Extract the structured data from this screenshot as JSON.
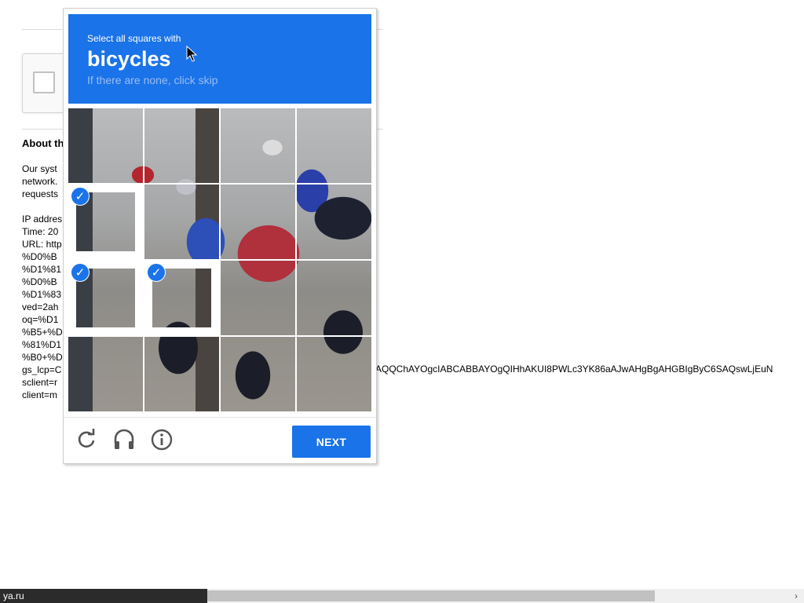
{
  "background_page": {
    "about_heading": "About th",
    "paragraph_lines": [
      "Our syst",
      "network.",
      "requests"
    ],
    "detail_lines": [
      "IP addres",
      "Time: 20",
      "URL: http",
      "%D0%B",
      "%D1%81",
      "%D0%B",
      "%D1%83",
      "ved=2ah",
      "oq=%D1",
      "%B5+%D",
      "%81%D1",
      "%B0+%D",
      "gs_lcp=C",
      "sclient=r",
      "client=m"
    ],
    "overflow_text": "AQQChAYOgcIABCABBAYOgQIHhAKUI8PWLc3YK86aAJwAHgBgAHGBIgByC6SAQswLjEuN"
  },
  "captcha": {
    "instruction": "Select all squares with",
    "keyword": "bicycles",
    "sub_instruction": "If there are none, click skip",
    "tiles": [
      {
        "row": 0,
        "col": 0,
        "selected": false
      },
      {
        "row": 0,
        "col": 1,
        "selected": false
      },
      {
        "row": 0,
        "col": 2,
        "selected": false
      },
      {
        "row": 0,
        "col": 3,
        "selected": false
      },
      {
        "row": 1,
        "col": 0,
        "selected": true
      },
      {
        "row": 1,
        "col": 1,
        "selected": false
      },
      {
        "row": 1,
        "col": 2,
        "selected": false
      },
      {
        "row": 1,
        "col": 3,
        "selected": false
      },
      {
        "row": 2,
        "col": 0,
        "selected": true
      },
      {
        "row": 2,
        "col": 1,
        "selected": true
      },
      {
        "row": 2,
        "col": 2,
        "selected": false
      },
      {
        "row": 2,
        "col": 3,
        "selected": false
      },
      {
        "row": 3,
        "col": 0,
        "selected": false
      },
      {
        "row": 3,
        "col": 1,
        "selected": false
      },
      {
        "row": 3,
        "col": 2,
        "selected": false
      },
      {
        "row": 3,
        "col": 3,
        "selected": false
      }
    ],
    "footer": {
      "icons": [
        "reload-icon",
        "headphones-icon",
        "info-icon"
      ],
      "next_label": "NEXT"
    },
    "colors": {
      "accent": "#1a73e8",
      "subtext": "#9bbcf3"
    }
  },
  "status_bar": {
    "url": "ya.ru"
  }
}
